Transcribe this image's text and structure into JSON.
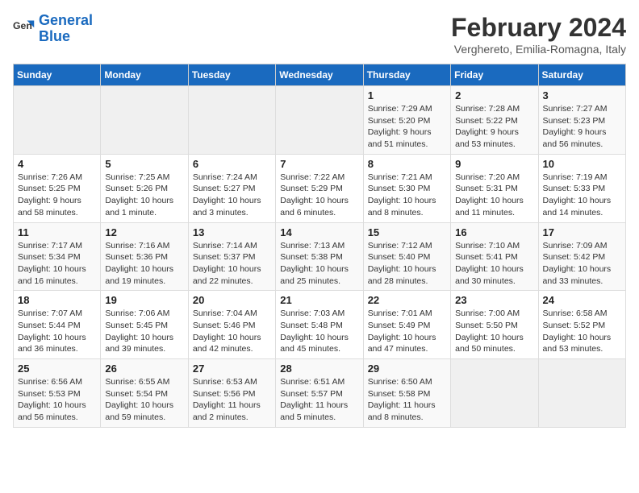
{
  "logo": {
    "line1": "General",
    "line2": "Blue"
  },
  "title": "February 2024",
  "subtitle": "Verghereto, Emilia-Romagna, Italy",
  "days_of_week": [
    "Sunday",
    "Monday",
    "Tuesday",
    "Wednesday",
    "Thursday",
    "Friday",
    "Saturday"
  ],
  "weeks": [
    [
      {
        "num": "",
        "info": ""
      },
      {
        "num": "",
        "info": ""
      },
      {
        "num": "",
        "info": ""
      },
      {
        "num": "",
        "info": ""
      },
      {
        "num": "1",
        "info": "Sunrise: 7:29 AM\nSunset: 5:20 PM\nDaylight: 9 hours and 51 minutes."
      },
      {
        "num": "2",
        "info": "Sunrise: 7:28 AM\nSunset: 5:22 PM\nDaylight: 9 hours and 53 minutes."
      },
      {
        "num": "3",
        "info": "Sunrise: 7:27 AM\nSunset: 5:23 PM\nDaylight: 9 hours and 56 minutes."
      }
    ],
    [
      {
        "num": "4",
        "info": "Sunrise: 7:26 AM\nSunset: 5:25 PM\nDaylight: 9 hours and 58 minutes."
      },
      {
        "num": "5",
        "info": "Sunrise: 7:25 AM\nSunset: 5:26 PM\nDaylight: 10 hours and 1 minute."
      },
      {
        "num": "6",
        "info": "Sunrise: 7:24 AM\nSunset: 5:27 PM\nDaylight: 10 hours and 3 minutes."
      },
      {
        "num": "7",
        "info": "Sunrise: 7:22 AM\nSunset: 5:29 PM\nDaylight: 10 hours and 6 minutes."
      },
      {
        "num": "8",
        "info": "Sunrise: 7:21 AM\nSunset: 5:30 PM\nDaylight: 10 hours and 8 minutes."
      },
      {
        "num": "9",
        "info": "Sunrise: 7:20 AM\nSunset: 5:31 PM\nDaylight: 10 hours and 11 minutes."
      },
      {
        "num": "10",
        "info": "Sunrise: 7:19 AM\nSunset: 5:33 PM\nDaylight: 10 hours and 14 minutes."
      }
    ],
    [
      {
        "num": "11",
        "info": "Sunrise: 7:17 AM\nSunset: 5:34 PM\nDaylight: 10 hours and 16 minutes."
      },
      {
        "num": "12",
        "info": "Sunrise: 7:16 AM\nSunset: 5:36 PM\nDaylight: 10 hours and 19 minutes."
      },
      {
        "num": "13",
        "info": "Sunrise: 7:14 AM\nSunset: 5:37 PM\nDaylight: 10 hours and 22 minutes."
      },
      {
        "num": "14",
        "info": "Sunrise: 7:13 AM\nSunset: 5:38 PM\nDaylight: 10 hours and 25 minutes."
      },
      {
        "num": "15",
        "info": "Sunrise: 7:12 AM\nSunset: 5:40 PM\nDaylight: 10 hours and 28 minutes."
      },
      {
        "num": "16",
        "info": "Sunrise: 7:10 AM\nSunset: 5:41 PM\nDaylight: 10 hours and 30 minutes."
      },
      {
        "num": "17",
        "info": "Sunrise: 7:09 AM\nSunset: 5:42 PM\nDaylight: 10 hours and 33 minutes."
      }
    ],
    [
      {
        "num": "18",
        "info": "Sunrise: 7:07 AM\nSunset: 5:44 PM\nDaylight: 10 hours and 36 minutes."
      },
      {
        "num": "19",
        "info": "Sunrise: 7:06 AM\nSunset: 5:45 PM\nDaylight: 10 hours and 39 minutes."
      },
      {
        "num": "20",
        "info": "Sunrise: 7:04 AM\nSunset: 5:46 PM\nDaylight: 10 hours and 42 minutes."
      },
      {
        "num": "21",
        "info": "Sunrise: 7:03 AM\nSunset: 5:48 PM\nDaylight: 10 hours and 45 minutes."
      },
      {
        "num": "22",
        "info": "Sunrise: 7:01 AM\nSunset: 5:49 PM\nDaylight: 10 hours and 47 minutes."
      },
      {
        "num": "23",
        "info": "Sunrise: 7:00 AM\nSunset: 5:50 PM\nDaylight: 10 hours and 50 minutes."
      },
      {
        "num": "24",
        "info": "Sunrise: 6:58 AM\nSunset: 5:52 PM\nDaylight: 10 hours and 53 minutes."
      }
    ],
    [
      {
        "num": "25",
        "info": "Sunrise: 6:56 AM\nSunset: 5:53 PM\nDaylight: 10 hours and 56 minutes."
      },
      {
        "num": "26",
        "info": "Sunrise: 6:55 AM\nSunset: 5:54 PM\nDaylight: 10 hours and 59 minutes."
      },
      {
        "num": "27",
        "info": "Sunrise: 6:53 AM\nSunset: 5:56 PM\nDaylight: 11 hours and 2 minutes."
      },
      {
        "num": "28",
        "info": "Sunrise: 6:51 AM\nSunset: 5:57 PM\nDaylight: 11 hours and 5 minutes."
      },
      {
        "num": "29",
        "info": "Sunrise: 6:50 AM\nSunset: 5:58 PM\nDaylight: 11 hours and 8 minutes."
      },
      {
        "num": "",
        "info": ""
      },
      {
        "num": "",
        "info": ""
      }
    ]
  ]
}
